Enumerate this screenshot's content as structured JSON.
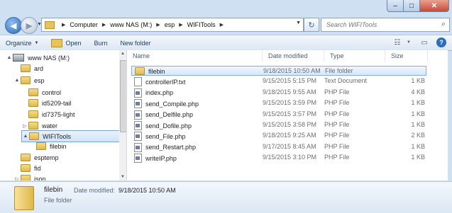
{
  "window": {
    "controls": {
      "minimize": "–",
      "maximize": "□",
      "close": "✕"
    }
  },
  "address": {
    "crumbs": [
      "Computer",
      "www NAS (M:)",
      "esp",
      "WIFITools"
    ]
  },
  "search": {
    "placeholder": "Search WIFITools"
  },
  "toolbar": {
    "organize": "Organize",
    "open": "Open",
    "burn": "Burn",
    "new_folder": "New folder"
  },
  "tree": [
    {
      "label": "www NAS (M:)",
      "level": 0,
      "icon": "nas-drive-icon",
      "arrow": "▲"
    },
    {
      "label": "ard",
      "level": 1,
      "icon": "folder-icon",
      "arrow": ""
    },
    {
      "label": "esp",
      "level": 1,
      "icon": "folder-icon",
      "arrow": "▲"
    },
    {
      "label": "control",
      "level": 2,
      "icon": "folder-icon",
      "arrow": ""
    },
    {
      "label": "id5209-tail",
      "level": 2,
      "icon": "folder-icon",
      "arrow": ""
    },
    {
      "label": "id7375-light",
      "level": 2,
      "icon": "folder-icon",
      "arrow": ""
    },
    {
      "label": "water",
      "level": 2,
      "icon": "folder-icon",
      "arrow": "▷"
    },
    {
      "label": "WIFITools",
      "level": 2,
      "icon": "folder-icon",
      "arrow": "▲",
      "selected": true
    },
    {
      "label": "filebin",
      "level": 3,
      "icon": "folder-icon",
      "arrow": ""
    },
    {
      "label": "esptemp",
      "level": 1,
      "icon": "folder-icon",
      "arrow": ""
    },
    {
      "label": "fid",
      "level": 1,
      "icon": "folder-icon",
      "arrow": ""
    },
    {
      "label": "json",
      "level": 1,
      "icon": "folder-icon",
      "arrow": "▷"
    }
  ],
  "columns": {
    "name": "Name",
    "date": "Date modified",
    "type": "Type",
    "size": "Size"
  },
  "files": [
    {
      "name": "filebin",
      "date": "9/18/2015 10:50 AM",
      "type": "File folder",
      "size": "",
      "icon": "folder-icon",
      "selected": true
    },
    {
      "name": "controllerIP.txt",
      "date": "9/15/2015 5:15 PM",
      "type": "Text Document",
      "size": "1 KB",
      "icon": "text-file-icon"
    },
    {
      "name": "index.php",
      "date": "9/18/2015 9:55 AM",
      "type": "PHP File",
      "size": "4 KB",
      "icon": "php-file-icon"
    },
    {
      "name": "send_Compile.php",
      "date": "9/15/2015 3:59 PM",
      "type": "PHP File",
      "size": "1 KB",
      "icon": "php-file-icon"
    },
    {
      "name": "send_Delfile.php",
      "date": "9/15/2015 3:57 PM",
      "type": "PHP File",
      "size": "1 KB",
      "icon": "php-file-icon"
    },
    {
      "name": "send_Dofile.php",
      "date": "9/15/2015 3:58 PM",
      "type": "PHP File",
      "size": "1 KB",
      "icon": "php-file-icon"
    },
    {
      "name": "send_File.php",
      "date": "9/18/2015 9:25 AM",
      "type": "PHP File",
      "size": "2 KB",
      "icon": "php-file-icon"
    },
    {
      "name": "send_Restart.php",
      "date": "9/17/2015 8:45 AM",
      "type": "PHP File",
      "size": "1 KB",
      "icon": "php-file-icon"
    },
    {
      "name": "writeIP.php",
      "date": "9/15/2015 3:10 PM",
      "type": "PHP File",
      "size": "1 KB",
      "icon": "php-file-icon"
    }
  ],
  "details": {
    "name": "filebin",
    "date_label": "Date modified:",
    "date_value": "9/18/2015 10:50 AM",
    "type": "File folder"
  }
}
